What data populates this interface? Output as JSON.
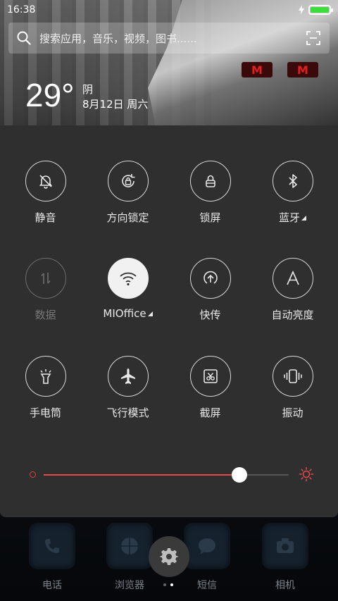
{
  "status_bar": {
    "time": "16:38",
    "battery_level": 1.0,
    "charging": true
  },
  "search": {
    "placeholder": "搜索应用，音乐，视频，图书......"
  },
  "weather": {
    "temperature": "29°",
    "condition": "阴",
    "date": "8月12日 周六"
  },
  "toggles": [
    {
      "label": "静音",
      "icon": "bell-off-icon",
      "state": "off"
    },
    {
      "label": "方向锁定",
      "icon": "rotation-lock-icon",
      "state": "off"
    },
    {
      "label": "锁屏",
      "icon": "lock-icon",
      "state": "off"
    },
    {
      "label": "蓝牙",
      "icon": "bluetooth-icon",
      "state": "off",
      "has_more": true
    },
    {
      "label": "数据",
      "icon": "mobile-data-icon",
      "state": "disabled"
    },
    {
      "label": "MIOffice",
      "icon": "wifi-icon",
      "state": "on",
      "has_more": true
    },
    {
      "label": "快传",
      "icon": "share-icon",
      "state": "off"
    },
    {
      "label": "自动亮度",
      "icon": "auto-brightness-icon",
      "state": "off"
    },
    {
      "label": "手电筒",
      "icon": "flashlight-icon",
      "state": "off"
    },
    {
      "label": "飞行模式",
      "icon": "airplane-icon",
      "state": "off"
    },
    {
      "label": "截屏",
      "icon": "screenshot-icon",
      "state": "off"
    },
    {
      "label": "振动",
      "icon": "vibrate-icon",
      "state": "off"
    }
  ],
  "brightness": {
    "level": 0.8
  },
  "dock": [
    {
      "label": "电话",
      "icon": "phone-icon"
    },
    {
      "label": "浏览器",
      "icon": "browser-icon"
    },
    {
      "label": "短信",
      "icon": "message-icon"
    },
    {
      "label": "相机",
      "icon": "camera-icon"
    }
  ],
  "colors": {
    "panel_bg": "#2f2f2f",
    "accent": "#e84a4a",
    "battery": "#3ddc3d"
  }
}
